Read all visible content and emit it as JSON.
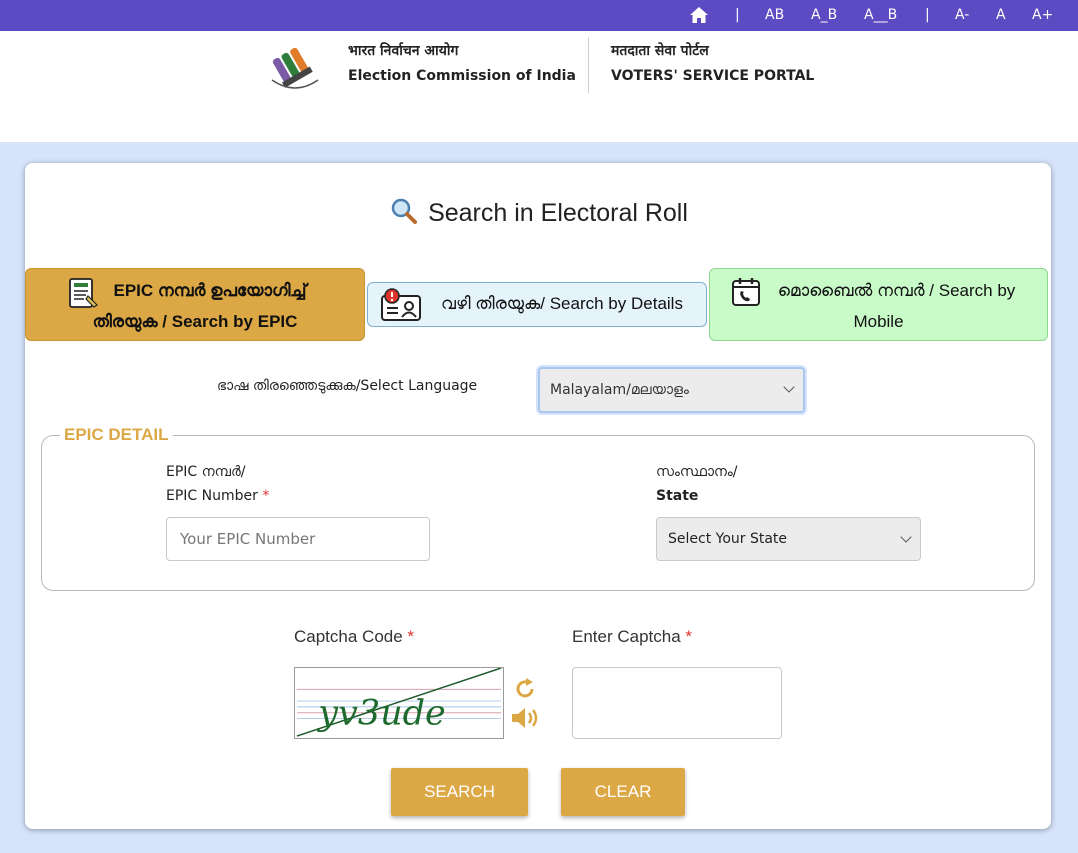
{
  "topbar": {
    "home_icon": "home-icon",
    "sep1": "|",
    "ab1": "AB",
    "ab2": "A_B",
    "ab3": "A__B",
    "sep2": "|",
    "font_minus": "A-",
    "font_normal": "A",
    "font_plus": "A+",
    "bg_color": "#5c4bc2"
  },
  "header": {
    "eci_hindi": "भारत निर्वाचन आयोग",
    "eci_english": "Election Commission of India",
    "portal_hindi": "मतदाता सेवा पोर्टल",
    "portal_english": "VOTERS' SERVICE PORTAL"
  },
  "page": {
    "title": "Search in Electoral Roll",
    "title_icon": "magnifier-icon"
  },
  "tabs": [
    {
      "line1": "EPIC നമ്പർ ഉപയോഗിച്ച്",
      "line2": "തിരയുക / Search by EPIC",
      "icon": "epic-card-icon",
      "color": "#dca845"
    },
    {
      "line1": "വഴി തിരയുക/ Search by Details",
      "icon": "details-card-icon",
      "color": "#e5f3fb"
    },
    {
      "line1": "മൊബൈൽ നമ്പർ / Search by",
      "line2": "Mobile",
      "icon": "mobile-calendar-icon",
      "color": "#c9fbc9"
    }
  ],
  "language": {
    "label": "ഭാഷ തിരഞ്ഞെടുക്കുക/Select Language",
    "selected": "Malayalam/മലയാളം"
  },
  "epic_detail": {
    "legend": "EPIC DETAIL",
    "epic_label_ml": "EPIC നമ്പർ/",
    "epic_label_en": "EPIC Number",
    "required_mark": "*",
    "epic_placeholder": "Your EPIC Number",
    "state_label_ml": "സംസ്ഥാനം/",
    "state_label_en": "State",
    "state_selected": "Select Your State"
  },
  "captcha": {
    "code_label": "Captcha Code",
    "enter_label": "Enter Captcha",
    "required_mark": "*",
    "captcha_text": "yv3ude",
    "refresh_icon": "refresh-icon",
    "audio_icon": "speaker-icon"
  },
  "buttons": {
    "search": "SEARCH",
    "clear": "CLEAR"
  },
  "colors": {
    "accent": "#dca845",
    "background": "#d6e3fb",
    "required": "#e0332d"
  }
}
